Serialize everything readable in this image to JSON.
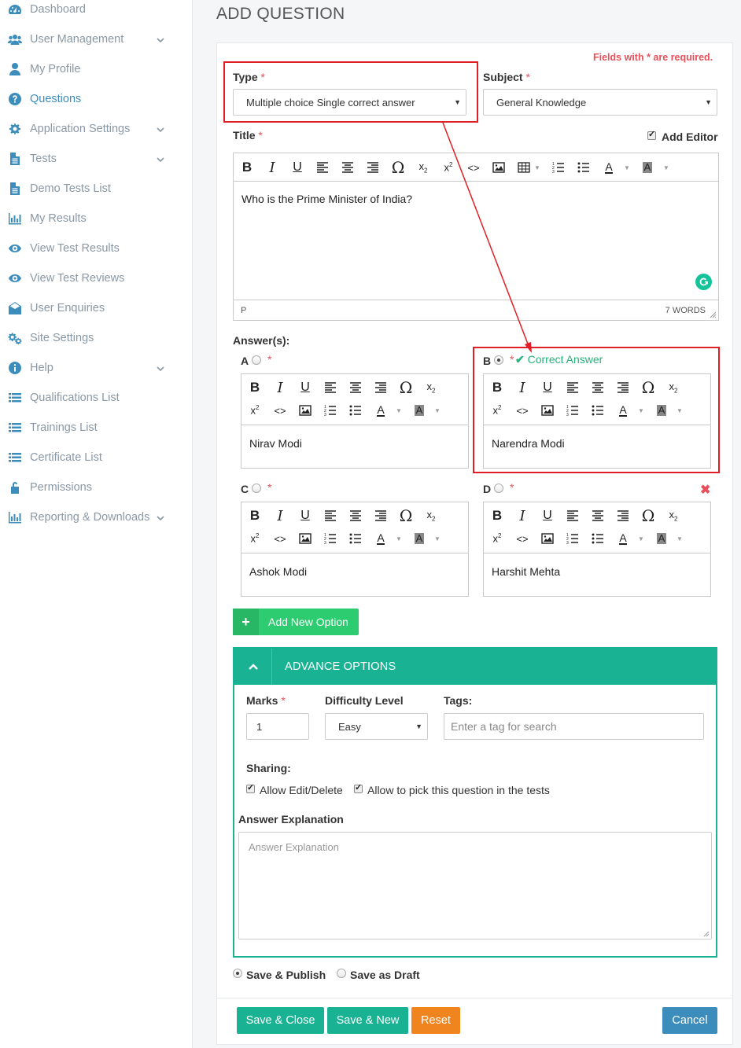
{
  "sidebar": {
    "items": [
      {
        "label": "Dashboard",
        "icon": "dashboard-icon",
        "chevron": false
      },
      {
        "label": "User Management",
        "icon": "users-icon",
        "chevron": true
      },
      {
        "label": "My Profile",
        "icon": "user-icon",
        "chevron": false
      },
      {
        "label": "Questions",
        "icon": "question-circle-icon",
        "chevron": false,
        "active": true
      },
      {
        "label": "Application Settings",
        "icon": "gear-icon",
        "chevron": true
      },
      {
        "label": "Tests",
        "icon": "file-icon",
        "chevron": true
      },
      {
        "label": "Demo Tests List",
        "icon": "file-icon",
        "chevron": false
      },
      {
        "label": "My Results",
        "icon": "bar-chart-icon",
        "chevron": false
      },
      {
        "label": "View Test Results",
        "icon": "eye-icon",
        "chevron": false
      },
      {
        "label": "View Test Reviews",
        "icon": "eye-icon",
        "chevron": false
      },
      {
        "label": "User Enquiries",
        "icon": "envelope-open-icon",
        "chevron": false
      },
      {
        "label": "Site Settings",
        "icon": "gears-icon",
        "chevron": false
      },
      {
        "label": "Help",
        "icon": "info-circle-icon",
        "chevron": true
      },
      {
        "label": "Qualifications List",
        "icon": "list-icon",
        "chevron": false
      },
      {
        "label": "Trainings List",
        "icon": "list-icon",
        "chevron": false
      },
      {
        "label": "Certificate List",
        "icon": "list-icon",
        "chevron": false
      },
      {
        "label": "Permissions",
        "icon": "unlock-icon",
        "chevron": false
      },
      {
        "label": "Reporting & Downloads",
        "icon": "bar-chart-icon",
        "chevron": true
      }
    ]
  },
  "page": {
    "title": "ADD QUESTION",
    "required_note": "Fields with * are required."
  },
  "form": {
    "type_label": "Type",
    "type_value": "Multiple choice Single correct answer",
    "subject_label": "Subject",
    "subject_value": "General Knowledge",
    "title_label": "Title",
    "add_editor_label": "Add Editor",
    "title_content": "Who is the Prime Minister of India?",
    "status_path": "P",
    "word_count": "7 WORDS",
    "answers_label": "Answer(s):",
    "star": "*",
    "correct_answer_label": "Correct Answer",
    "options": [
      {
        "letter": "A",
        "text": "Nirav Modi"
      },
      {
        "letter": "B",
        "text": "Narendra Modi"
      },
      {
        "letter": "C",
        "text": "Ashok Modi"
      },
      {
        "letter": "D",
        "text": "Harshit Mehta"
      }
    ],
    "add_option_label": "Add New Option"
  },
  "advance": {
    "title": "ADVANCE OPTIONS",
    "marks_label": "Marks",
    "marks_value": "1",
    "difficulty_label": "Difficulty Level",
    "difficulty_value": "Easy",
    "tags_label": "Tags:",
    "tags_placeholder": "Enter a tag for search",
    "sharing_label": "Sharing:",
    "allow_edit_label": "Allow Edit/Delete",
    "allow_pick_label": "Allow to pick this question in the tests",
    "explanation_label": "Answer Explanation",
    "explanation_placeholder": "Answer Explanation"
  },
  "save_options": {
    "publish_label": "Save & Publish",
    "draft_label": "Save as Draft"
  },
  "buttons": {
    "save_close": "Save & Close",
    "save_new": "Save & New",
    "reset": "Reset",
    "cancel": "Cancel"
  },
  "colors": {
    "accent_blue": "#3c8dbc",
    "teal": "#19b394",
    "green": "#2ecc71",
    "orange": "#f0841f",
    "cancel_blue": "#3c8dbc",
    "required_red": "#e8505b",
    "highlight_red": "#e21f26"
  }
}
